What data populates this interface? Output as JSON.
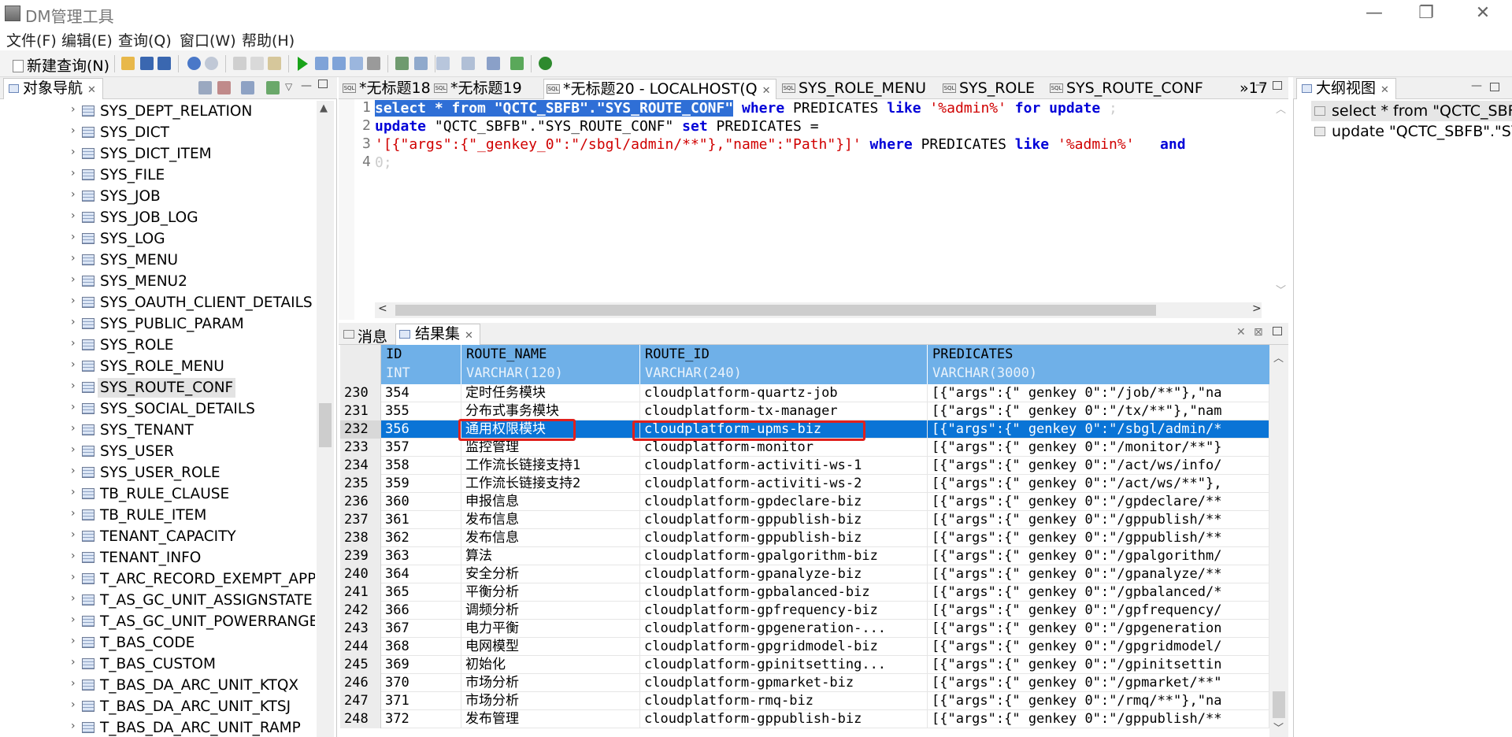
{
  "window": {
    "title": "DM管理工具",
    "min": "—",
    "max": "❐",
    "close": "✕"
  },
  "menu": [
    "文件(F)",
    "编辑(E)",
    "查询(Q)",
    "窗口(W)",
    "帮助(H)"
  ],
  "toolbar": {
    "new_query": "新建查询(N)"
  },
  "nav": {
    "tab": "对象导航",
    "items": [
      "SYS_DEPT_RELATION",
      "SYS_DICT",
      "SYS_DICT_ITEM",
      "SYS_FILE",
      "SYS_JOB",
      "SYS_JOB_LOG",
      "SYS_LOG",
      "SYS_MENU",
      "SYS_MENU2",
      "SYS_OAUTH_CLIENT_DETAILS",
      "SYS_PUBLIC_PARAM",
      "SYS_ROLE",
      "SYS_ROLE_MENU",
      "SYS_ROUTE_CONF",
      "SYS_SOCIAL_DETAILS",
      "SYS_TENANT",
      "SYS_USER",
      "SYS_USER_ROLE",
      "TB_RULE_CLAUSE",
      "TB_RULE_ITEM",
      "TENANT_CAPACITY",
      "TENANT_INFO",
      "T_ARC_RECORD_EXEMPT_APPLY",
      "T_AS_GC_UNIT_ASSIGNSTATE",
      "T_AS_GC_UNIT_POWERRANGE",
      "T_BAS_CODE",
      "T_BAS_CUSTOM",
      "T_BAS_DA_ARC_UNIT_KTQX",
      "T_BAS_DA_ARC_UNIT_KTSJ",
      "T_BAS_DA_ARC_UNIT_RAMP"
    ],
    "selected": "SYS_ROUTE_CONF"
  },
  "editor_tabs": [
    "*无标题18",
    "*无标题19",
    "*无标题20 - LOCALHOST(Q",
    "SYS_ROLE_MENU",
    "SYS_ROLE",
    "SYS_ROUTE_CONF",
    "»17"
  ],
  "sql_badge": "SQL",
  "editor": {
    "line_numbers": [
      "1",
      "2",
      "3",
      "4"
    ],
    "l1": {
      "sel": "select * from \"QCTC_SBFB\".\"SYS_ROUTE_CONF\"",
      "a": " where",
      "b": " PREDICATES ",
      "c": "like",
      "d": " '%admin%'",
      "e": " for update",
      "f": " ;"
    },
    "l2": {
      "a": "update",
      "b": " \"QCTC_SBFB\".\"SYS_ROUTE_CONF\" ",
      "c": "set",
      "d": " PREDICATES ="
    },
    "l3": {
      "a": "'[{\"args\":{\"_genkey_0\":\"/sbgl/admin/**\"},\"name\":\"Path\"}]'",
      "b": " where",
      "c": " PREDICATES ",
      "d": "like",
      "e": " '%admin%'",
      "f": "   and"
    },
    "l4": "0;"
  },
  "result_tabs": [
    "消息",
    "结果集"
  ],
  "columns": [
    {
      "name": "ID",
      "type": "INT"
    },
    {
      "name": "ROUTE_NAME",
      "type": "VARCHAR(120)"
    },
    {
      "name": "ROUTE_ID",
      "type": "VARCHAR(240)"
    },
    {
      "name": "PREDICATES",
      "type": "VARCHAR(3000)"
    }
  ],
  "rows": [
    [
      "230",
      "354",
      "定时任务模块",
      "cloudplatform-quartz-job",
      "[{\"args\":{\" genkey 0\":\"/job/**\"},\"na"
    ],
    [
      "231",
      "355",
      "分布式事务模块",
      "cloudplatform-tx-manager",
      "[{\"args\":{\" genkey 0\":\"/tx/**\"},\"nam"
    ],
    [
      "232",
      "356",
      "通用权限模块",
      "cloudplatform-upms-biz",
      "[{\"args\":{\" genkey 0\":\"/sbgl/admin/*"
    ],
    [
      "233",
      "357",
      "监控管理",
      "cloudplatform-monitor",
      "[{\"args\":{\" genkey 0\":\"/monitor/**\"}"
    ],
    [
      "234",
      "358",
      "工作流长链接支持1",
      "cloudplatform-activiti-ws-1",
      "[{\"args\":{\" genkey 0\":\"/act/ws/info/"
    ],
    [
      "235",
      "359",
      "工作流长链接支持2",
      "cloudplatform-activiti-ws-2",
      "[{\"args\":{\" genkey 0\":\"/act/ws/**\"},"
    ],
    [
      "236",
      "360",
      "申报信息",
      "cloudplatform-gpdeclare-biz",
      "[{\"args\":{\" genkey 0\":\"/gpdeclare/**"
    ],
    [
      "237",
      "361",
      "发布信息",
      "cloudplatform-gppublish-biz",
      "[{\"args\":{\" genkey 0\":\"/gppublish/**"
    ],
    [
      "238",
      "362",
      "发布信息",
      "cloudplatform-gppublish-biz",
      "[{\"args\":{\" genkey 0\":\"/gppublish/**"
    ],
    [
      "239",
      "363",
      "算法",
      "cloudplatform-gpalgorithm-biz",
      "[{\"args\":{\" genkey 0\":\"/gpalgorithm/"
    ],
    [
      "240",
      "364",
      "安全分析",
      "cloudplatform-gpanalyze-biz",
      "[{\"args\":{\" genkey 0\":\"/gpanalyze/**"
    ],
    [
      "241",
      "365",
      "平衡分析",
      "cloudplatform-gpbalanced-biz",
      "[{\"args\":{\" genkey 0\":\"/gpbalanced/*"
    ],
    [
      "242",
      "366",
      "调频分析",
      "cloudplatform-gpfrequency-biz",
      "[{\"args\":{\" genkey 0\":\"/gpfrequency/"
    ],
    [
      "243",
      "367",
      "电力平衡",
      "cloudplatform-gpgeneration-...",
      "[{\"args\":{\" genkey 0\":\"/gpgeneration"
    ],
    [
      "244",
      "368",
      "电网模型",
      "cloudplatform-gpgridmodel-biz",
      "[{\"args\":{\" genkey 0\":\"/gpgridmodel/"
    ],
    [
      "245",
      "369",
      "初始化",
      "cloudplatform-gpinitsetting...",
      "[{\"args\":{\" genkey 0\":\"/gpinitsettin"
    ],
    [
      "246",
      "370",
      "市场分析",
      "cloudplatform-gpmarket-biz",
      "[{\"args\":{\" genkey 0\":\"/gpmarket/**\""
    ],
    [
      "247",
      "371",
      "市场分析",
      "cloudplatform-rmq-biz",
      "[{\"args\":{\" genkey 0\":\"/rmq/**\"},\"na"
    ],
    [
      "248",
      "372",
      "发布管理",
      "cloudplatform-gppublish-biz",
      "[{\"args\":{\" genkey 0\":\"/gppublish/**"
    ]
  ],
  "highlight_row": "232",
  "outline": {
    "tab": "大纲视图",
    "items": [
      "select * from \"QCTC_SBFB\"",
      "update \"QCTC_SBFB\".\"SYS"
    ]
  }
}
